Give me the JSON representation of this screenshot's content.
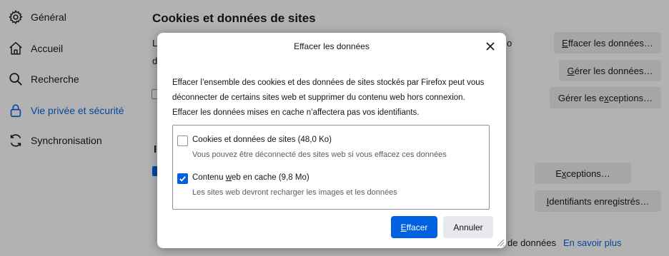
{
  "sidebar": {
    "items": [
      {
        "label": "Général",
        "icon": "gear-icon"
      },
      {
        "label": "Accueil",
        "icon": "home-icon"
      },
      {
        "label": "Recherche",
        "icon": "search-icon"
      },
      {
        "label": "Vie privée et sécurité",
        "icon": "lock-icon",
        "active": true
      },
      {
        "label": "Synchronisation",
        "icon": "sync-icon"
      }
    ]
  },
  "main": {
    "section_title": "Cookies et données de sites",
    "fragment_l": "L",
    "fragment_d": "d",
    "fragment_o": "o",
    "fragment_i": "I",
    "buttons": {
      "clear_data_pre": "",
      "clear_data_ul": "E",
      "clear_data_post": "ffacer les données…",
      "manage_data_pre": "",
      "manage_data_ul": "G",
      "manage_data_post": "érer les données…",
      "manage_exc_pre": "Gérer les e",
      "manage_exc_ul": "x",
      "manage_exc_post": "ceptions…",
      "exceptions_pre": "E",
      "exceptions_ul": "x",
      "exceptions_post": "ceptions…",
      "saved_ids_pre": "",
      "saved_ids_ul": "I",
      "saved_ids_post": "dentifiants enregistrés…"
    },
    "bottom_text": "de données",
    "learn_more": "En savoir plus"
  },
  "dialog": {
    "title": "Effacer les données",
    "description": [
      "Effacer l’ensemble des cookies et des données de sites stockés par Firefox peut vous",
      "déconnecter de certains sites web et supprimer du contenu web hors connexion.",
      "Effacer les données mises en cache n’affectera pas vos identifiants."
    ],
    "options": [
      {
        "label": "Cookies et données de sites (48,0 Ko)",
        "sublabel": "Vous pouvez être déconnecté des sites web si vous effacez ces données",
        "checked": false
      },
      {
        "label_pre": "Contenu ",
        "label_ul": "w",
        "label_post": "eb en cache (9,8 Mo)",
        "sublabel": "Les sites web devront recharger les images et les données",
        "checked": true
      }
    ],
    "clear_pre": "",
    "clear_ul": "E",
    "clear_post": "ffacer",
    "cancel": "Annuler"
  },
  "colors": {
    "accent": "#0061e0",
    "button_bg": "#e9e9ed",
    "text": "#15141a"
  }
}
